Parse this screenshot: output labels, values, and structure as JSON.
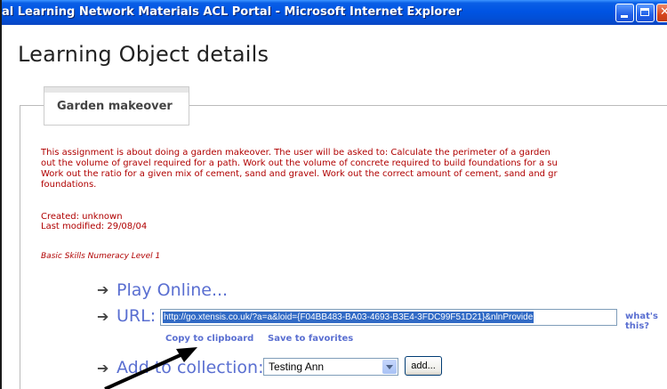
{
  "window": {
    "title": "al Learning Network Materials ACL Portal - Microsoft Internet Explorer"
  },
  "page": {
    "title": "Learning Object details"
  },
  "object": {
    "name": "Garden makeover",
    "description_lines": [
      "This assignment is about doing a garden makeover. The user will be asked to: Calculate the perimeter of a garden",
      "out the volume of gravel required for a path. Work out the volume of concrete required to build foundations for a su",
      "Work out the ratio for a given mix of cement, sand and gravel. Work out the correct amount of cement, sand and gr",
      "foundations."
    ],
    "created": "Created: unknown",
    "last_modified": "Last modified: 29/08/04",
    "level": "Basic Skills Numeracy Level 1"
  },
  "actions": {
    "play_online": "Play Online...",
    "url_label": "URL:",
    "url_value": "http://go.xtensis.co.uk/?a=a&loid={F04BB483-BA03-4693-B3E4-3FDC99F51D21}&nlnProvide",
    "whats_this": "what's this?",
    "copy_to_clipboard": "Copy to clipboard",
    "save_to_favorites": "Save to favorites",
    "add_to_collection": "Add to collection:",
    "collection_selected": "Testing Ann",
    "add_button": "add..."
  },
  "icons": {
    "bullet": "arrow-bullet-icon",
    "annotation": "pointer-arrow-icon"
  },
  "colors": {
    "titlebar": "#0054e3",
    "link": "#5a6fd1",
    "body_text": "#b00000",
    "selection": "#316ac5"
  }
}
